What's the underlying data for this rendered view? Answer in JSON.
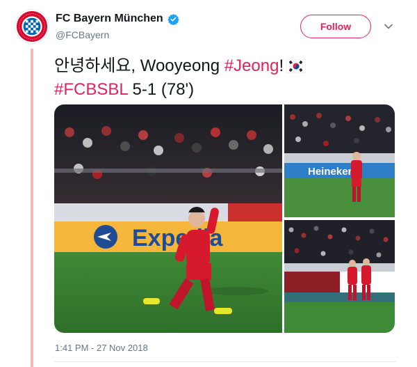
{
  "account": {
    "display_name": "FC Bayern München",
    "handle": "@FCBayern",
    "verified_icon": "verified-badge-icon",
    "avatar_text": "FC BAYERN MÜNCHEN"
  },
  "follow_label": "Follow",
  "tweet": {
    "line1_text": "안녕하세요, Wooyeong ",
    "line1_tag": "#Jeong",
    "line1_end": "!",
    "flag_icon": "south-korea-flag-icon",
    "line2_tag": "#FCBSBL",
    "line2_text": " 5-1 (78')"
  },
  "media": {
    "ad_board_text": "Expedia",
    "sponsor_board_text": "Heineken"
  },
  "timestamp": "1:41 PM - 27 Nov 2018",
  "colors": {
    "accent": "#e0245e",
    "verified": "#1da1f2",
    "bayern_red": "#dc052d",
    "thread_line": "#f6b8b2"
  }
}
